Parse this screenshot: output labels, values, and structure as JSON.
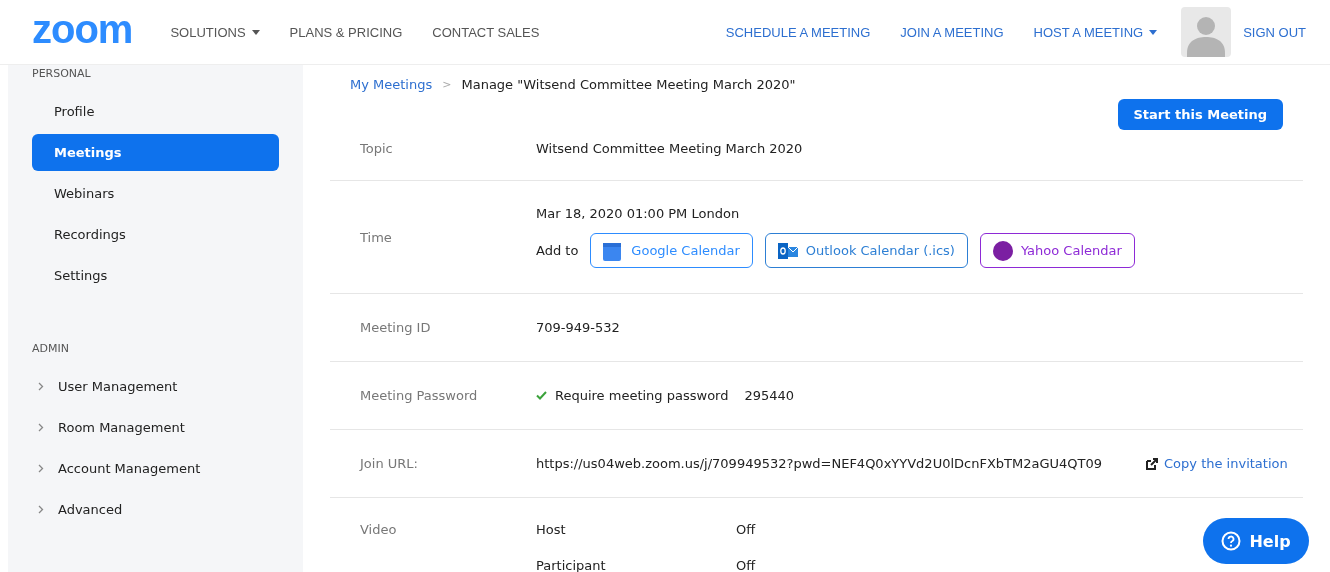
{
  "header": {
    "logo": "zoom",
    "nav_left": [
      {
        "label": "SOLUTIONS",
        "dropdown": true
      },
      {
        "label": "PLANS & PRICING",
        "dropdown": false
      },
      {
        "label": "CONTACT SALES",
        "dropdown": false
      }
    ],
    "nav_right": [
      {
        "label": "SCHEDULE A MEETING",
        "dropdown": false
      },
      {
        "label": "JOIN A MEETING",
        "dropdown": false
      },
      {
        "label": "HOST A MEETING",
        "dropdown": true
      }
    ],
    "sign_out": "SIGN OUT"
  },
  "sidebar": {
    "sections": [
      {
        "title": "PERSONAL",
        "items": [
          {
            "label": "Profile",
            "selected": false
          },
          {
            "label": "Meetings",
            "selected": true
          },
          {
            "label": "Webinars",
            "selected": false
          },
          {
            "label": "Recordings",
            "selected": false
          },
          {
            "label": "Settings",
            "selected": false
          }
        ]
      },
      {
        "title": "ADMIN",
        "items": [
          {
            "label": "User Management",
            "selected": false,
            "expanded": false
          },
          {
            "label": "Room Management",
            "selected": false,
            "expanded": false
          },
          {
            "label": "Account Management",
            "selected": false,
            "expanded": false
          },
          {
            "label": "Advanced",
            "selected": false,
            "expanded": false
          }
        ]
      }
    ]
  },
  "breadcrumb_separator": ">",
  "breadcrumb": [
    {
      "label": "My Meetings",
      "link": true
    },
    {
      "label": "Manage \"Witsend Committee Meeting March 2020\"",
      "link": false
    }
  ],
  "start_button": "Start this Meeting",
  "rows": [
    {
      "kind": "text",
      "label": "Topic",
      "value": "Witsend Committee Meeting March 2020"
    },
    {
      "kind": "time",
      "label": "Time",
      "value": "Mar 18, 2020 01:00 PM London",
      "add_to": "Add to",
      "calendars": [
        {
          "label": "Google Calendar",
          "kind": "google",
          "color": "#2d8cff"
        },
        {
          "label": "Outlook Calendar (.ics)",
          "kind": "outlook",
          "color": "#2d7fd4"
        },
        {
          "label": "Yahoo Calendar",
          "kind": "yahoo",
          "color": "#8e2ad6"
        }
      ]
    },
    {
      "kind": "text",
      "label": "Meeting ID",
      "value": "709-949-532"
    },
    {
      "kind": "password",
      "label": "Meeting Password",
      "checked": true,
      "value": "Require meeting password",
      "password": "295440"
    },
    {
      "kind": "url",
      "label": "Join URL:",
      "value": "https://us04web.zoom.us/j/709949532?pwd=NEF4Q0xYYVd2U0lDcnFXbTM2aGU4QT09",
      "action": "Copy the invitation"
    },
    {
      "kind": "video",
      "label": "Video",
      "items": [
        {
          "name": "Host",
          "value": "Off"
        },
        {
          "name": "Participant",
          "value": "Off"
        }
      ]
    }
  ],
  "help_button": "Help"
}
